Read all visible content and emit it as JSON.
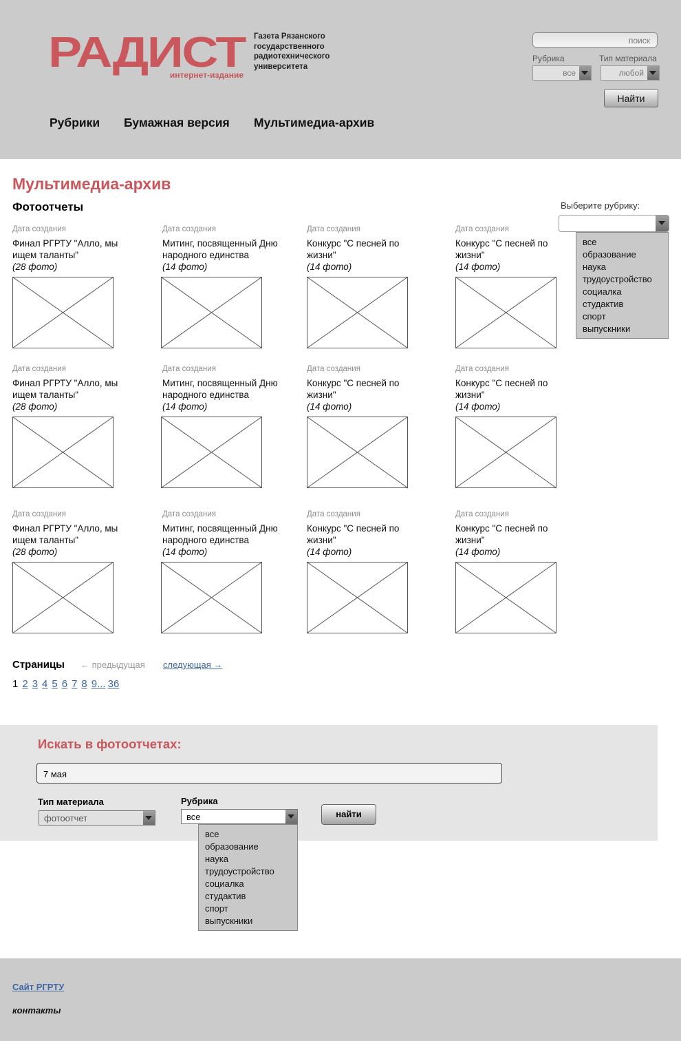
{
  "header": {
    "logo_text": "РАДИСТ",
    "logo_subtitle": "интернет-издание",
    "tagline": [
      "Газета Рязанского",
      "государственного",
      "радиотехнического",
      "университета"
    ],
    "search_placeholder": "поиск",
    "rubric_label": "Рубрика",
    "rubric_value": "все",
    "type_label": "Тип материала",
    "type_value": "любой",
    "find_button": "Найти",
    "nav": [
      "Рубрики",
      "Бумажная версия",
      "Мультимедиа-архив"
    ]
  },
  "main": {
    "title": "Мультимедиа-архив",
    "subtitle": "Фотоотчеты",
    "rubric_filter": {
      "label": "Выберите рубрику:",
      "value": "",
      "options": [
        "все",
        "образование",
        "наука",
        "трудоустройство",
        "социалка",
        "студактив",
        "спорт",
        "выпускники"
      ]
    },
    "rows": [
      [
        {
          "date": "Дата создания",
          "title": "Финал РГРТУ \"Алло, мы ищем таланты\"",
          "count": "(28 фото)"
        },
        {
          "date": "Дата создания",
          "title": "Митинг, посвященный Дню народного единства",
          "count": "(14 фото)"
        },
        {
          "date": "Дата создания",
          "title": "Конкурс \"С песней по жизни\"",
          "count": "(14 фото)"
        },
        {
          "date": "Дата создания",
          "title": "Конкурс \"С песней по жизни\"",
          "count": "(14 фото)"
        }
      ],
      [
        {
          "date": "Дата создания",
          "title": "Финал РГРТУ \"Алло, мы ищем таланты\"",
          "count": "(28 фото)"
        },
        {
          "date": "Дата создания",
          "title": "Митинг, посвященный Дню народного единства",
          "count": "(14 фото)"
        },
        {
          "date": "Дата создания",
          "title": "Конкурс \"С песней по жизни\"",
          "count": "(14 фото)"
        },
        {
          "date": "Дата создания",
          "title": "Конкурс \"С песней по жизни\"",
          "count": "(14 фото)"
        }
      ],
      [
        {
          "date": "Дата создания",
          "title": "Финал РГРТУ \"Алло, мы ищем таланты\"",
          "count": "(28 фото)"
        },
        {
          "date": "Дата создания",
          "title": "Митинг, посвященный Дню народного единства",
          "count": "(14 фото)"
        },
        {
          "date": "Дата создания",
          "title": "Конкурс \"С песней по жизни\"",
          "count": "(14 фото)"
        },
        {
          "date": "Дата создания",
          "title": "Конкурс \"С песней по жизни\"",
          "count": "(14 фото)"
        }
      ]
    ],
    "pagination": {
      "label": "Страницы",
      "prev": "← предыдущая",
      "next": "следующая →",
      "current": "1",
      "pages": [
        "2",
        "3",
        "4",
        "5",
        "6",
        "7",
        "8",
        "9",
        "...",
        "36"
      ]
    }
  },
  "search_panel": {
    "title": "Искать в фотоотчетах:",
    "query": "7 мая",
    "type_label": "Тип материала",
    "type_value": "фотоотчет",
    "rubric_label": "Рубрика",
    "rubric_value": "все",
    "rubric_options": [
      "все",
      "образование",
      "наука",
      "трудоустройство",
      "социалка",
      "студактив",
      "спорт",
      "выпускники"
    ],
    "button": "найти"
  },
  "footer": {
    "site_link": "Сайт РГРТУ",
    "contacts": "контакты"
  },
  "colors": {
    "accent_red": "#c9575b",
    "header_gray": "#cbcbcb",
    "panel_gray": "#e5e5e5",
    "link_blue": "#3e67a3"
  }
}
